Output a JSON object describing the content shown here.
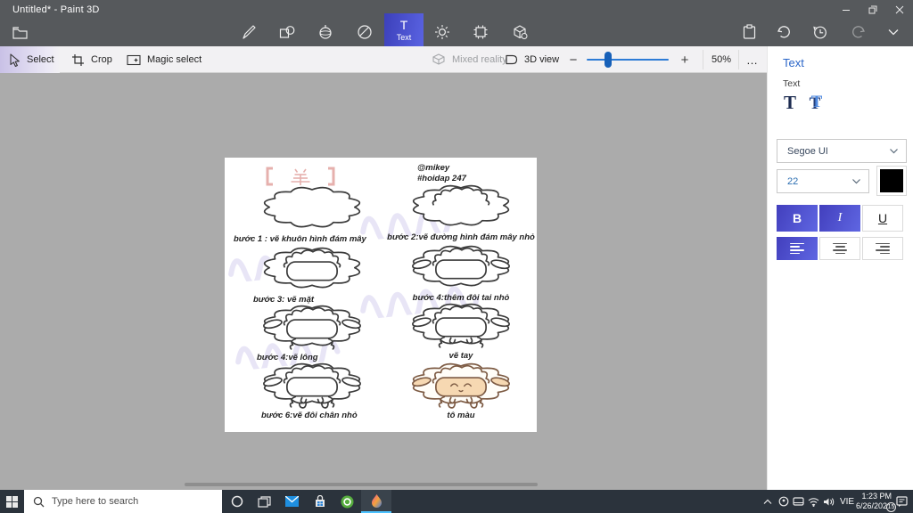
{
  "window": {
    "title": "Untitled* - Paint 3D"
  },
  "top_toolbar": {
    "text_tool_label": "Text",
    "tools": [
      "menu",
      "brush",
      "2d-shapes",
      "3d-shapes",
      "stickers",
      "text",
      "effects",
      "canvas",
      "3d-library"
    ],
    "history_tools": [
      "paste",
      "undo",
      "history",
      "redo",
      "expand"
    ]
  },
  "ribbon": {
    "select": "Select",
    "crop": "Crop",
    "magic_select": "Magic select",
    "mixed_reality": "Mixed reality",
    "view_3d": "3D view",
    "zoom_out": "−",
    "zoom_in": "+",
    "zoom_percent": "50%",
    "more": "…",
    "accent_color": "#2d7cd6"
  },
  "text_panel": {
    "title": "Text",
    "section_label": "Text",
    "type_2d": "T",
    "type_3d": "T",
    "font_name": "Segoe UI",
    "font_size": "22",
    "text_color": "#000000",
    "bold_label": "B",
    "italic_label": "I",
    "underline_label": "U",
    "accent_color": "#2b66c8"
  },
  "canvas": {
    "header": "【 羊 】",
    "header_color": "#e6b0ad",
    "credit1": "@mikey",
    "credit2": "#hoidap 247",
    "outline_color": "#3b3b3b",
    "colored_outline": "#7d5b44",
    "face_color": "#f6d8b2",
    "steps": [
      {
        "label": "bước 1 : vẽ khuôn hình đám mây",
        "parts": [
          "cloud"
        ]
      },
      {
        "label": "bước 2:vẽ  đường hình đám mây nhỏ",
        "parts": [
          "cloud",
          "tuft"
        ]
      },
      {
        "label": "bước 3: vẽ mặt",
        "parts": [
          "cloud",
          "tuft",
          "face"
        ]
      },
      {
        "label": "bước 4:thêm đôi tai nhỏ",
        "parts": [
          "cloud",
          "tuft",
          "face",
          "ears"
        ]
      },
      {
        "label": "bước 4:vẽ lông",
        "parts": [
          "cloud",
          "tuft",
          "face",
          "ears",
          "wool"
        ]
      },
      {
        "label": "vẽ tay",
        "parts": [
          "cloud",
          "tuft",
          "face",
          "ears",
          "wool",
          "hands"
        ]
      },
      {
        "label": "bước 6:vẽ đôi chân nhỏ",
        "parts": [
          "cloud",
          "tuft",
          "face",
          "ears",
          "wool",
          "hands",
          "legs"
        ]
      },
      {
        "label": "tô màu",
        "parts": [
          "cloud",
          "tuft",
          "face",
          "ears",
          "wool",
          "hands",
          "legs",
          "color"
        ]
      }
    ]
  },
  "taskbar": {
    "search_placeholder": "Type here to search",
    "language": "VIE",
    "time": "1:23 PM",
    "date": "6/26/2021",
    "notification_count": "15"
  }
}
